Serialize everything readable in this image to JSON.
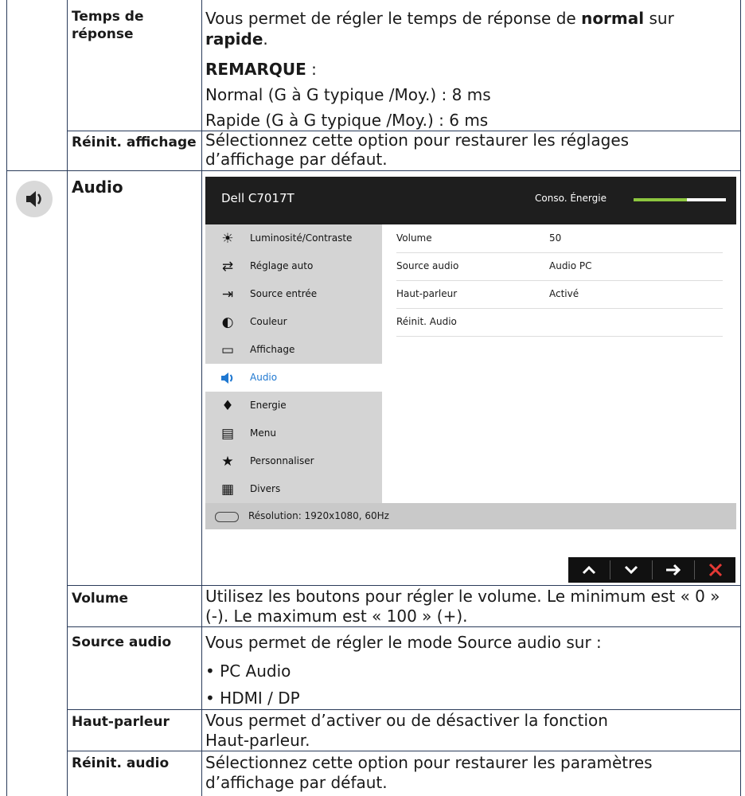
{
  "rows": {
    "temps": {
      "label": "Temps de\nréponse",
      "line1_a": "Vous permet de régler le temps de réponse de ",
      "line1_b": "normal",
      "line1_c": " sur",
      "line2_a": "rapide",
      "line2_b": ".",
      "note_label": "REMARQUE",
      "note_suffix": " :",
      "normal": "Normal (G à G typique /Moy.) : 8 ms",
      "rapide": "Rapide (G à G typique /Moy.) : 6 ms"
    },
    "reinit_affichage": {
      "label": "Réinit. affichage",
      "text": "Sélectionnez cette option pour restaurer les réglages d’affichage par défaut."
    },
    "audio": {
      "label": "Audio",
      "icon": "speaker-icon"
    },
    "volume": {
      "label": "Volume",
      "text": "Utilisez les boutons pour régler le volume. Le minimum est « 0 » (-). Le maximum est « 100 » (+)."
    },
    "source_audio": {
      "label": "Source audio",
      "text": "Vous permet de régler le mode Source audio sur :",
      "opt1": "• PC Audio",
      "opt2": "• HDMI / DP"
    },
    "haut_parleur": {
      "label": "Haut-parleur",
      "text": "Vous permet d’activer ou de désactiver la fonction Haut-parleur."
    },
    "reinit_audio": {
      "label": "Réinit. audio",
      "text": "Sélectionnez cette option pour restaurer les paramètres d’affichage par défaut."
    }
  },
  "osd": {
    "title": "Dell C7017T",
    "energy_label": "Conso. Énergie",
    "energy_level": 0.58,
    "energy_color": "#8dc63f",
    "menu": [
      {
        "label": "Luminosité/Contraste",
        "icon": "brightness-icon"
      },
      {
        "label": "Réglage auto",
        "icon": "auto-adjust-icon"
      },
      {
        "label": "Source entrée",
        "icon": "input-source-icon"
      },
      {
        "label": "Couleur",
        "icon": "color-icon"
      },
      {
        "label": "Affichage",
        "icon": "display-icon"
      },
      {
        "label": "Audio",
        "icon": "speaker-icon",
        "active": true
      },
      {
        "label": "Energie",
        "icon": "energy-icon"
      },
      {
        "label": "Menu",
        "icon": "menu-icon"
      },
      {
        "label": "Personnaliser",
        "icon": "star-icon"
      },
      {
        "label": "Divers",
        "icon": "others-icon"
      }
    ],
    "settings": [
      {
        "label": "Volume",
        "value": "50"
      },
      {
        "label": "Source audio",
        "value": "Audio PC"
      },
      {
        "label": "Haut-parleur",
        "value": "Activé"
      },
      {
        "label": "Réinit. Audio",
        "value": ""
      }
    ],
    "footer": "Résolution: 1920x1080, 60Hz",
    "accent": "#1f78d1"
  },
  "nav_buttons": {
    "up": "up-arrow-icon",
    "down": "down-arrow-icon",
    "right": "right-arrow-icon",
    "exit": "close-icon"
  }
}
